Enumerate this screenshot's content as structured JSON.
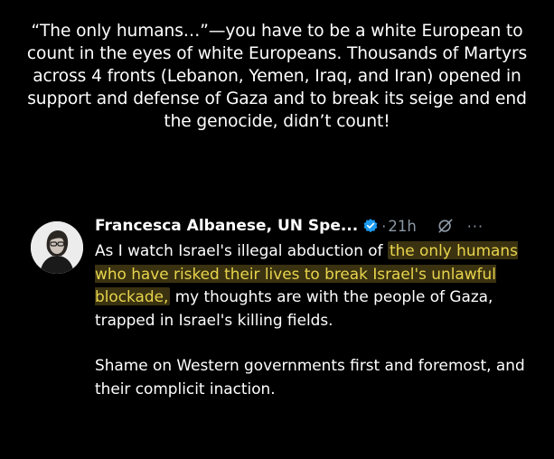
{
  "caption": "“The only humans…”—you have to be a white European to count in the eyes of white Europeans. Thousands of Martyrs across 4 fronts (Lebanon, Yemen, Iraq, and Iran) opened in support and defense of Gaza and to break its seige and end the genocide, didn’t count!",
  "tweet": {
    "display_name": "Francesca Albanese, UN Spe...",
    "verified_icon": "verified-badge-icon",
    "separator": "·",
    "time": "21h",
    "grok_icon": "grok-icon",
    "more": "···",
    "text_before": "As I watch Israel's illegal abduction of ",
    "text_highlight": "the only humans who have risked their lives to break Israel's unlawful blockade,",
    "text_after": " my thoughts are with the people of Gaza, trapped in Israel's killing fields.",
    "paragraph2": "Shame on Western governments first and foremost, and their complicit inaction."
  },
  "colors": {
    "background": "#000000",
    "text": "#ffffff",
    "muted": "#8b98a5",
    "highlight_text": "#e8d44d",
    "verified": "#1d9bf0"
  }
}
